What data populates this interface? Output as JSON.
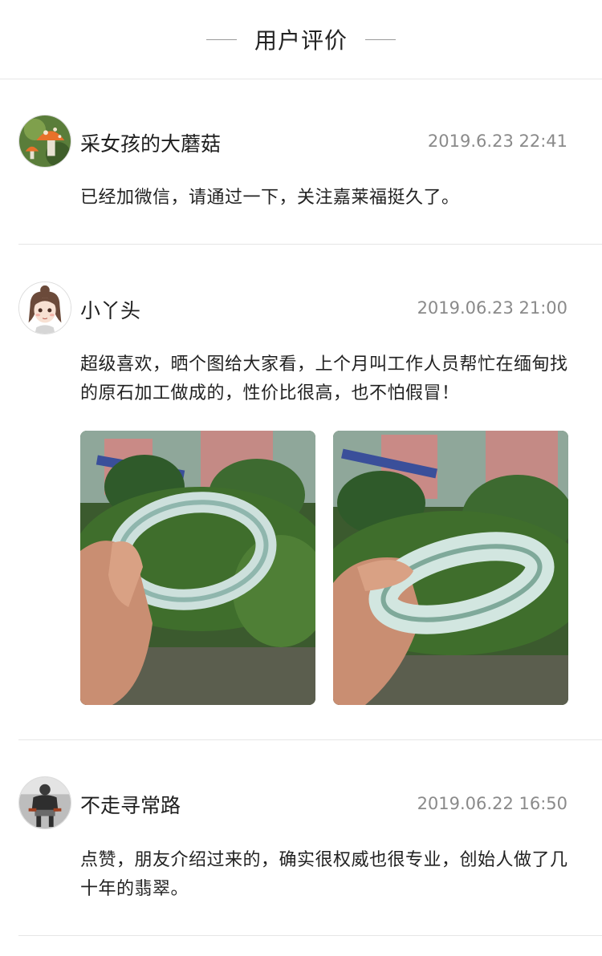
{
  "header": {
    "title": "用户评价"
  },
  "reviews": [
    {
      "username": "采女孩的大蘑菇",
      "time": "2019.6.23 22:41",
      "content": "已经加微信，请通过一下，关注嘉莱福挺久了。",
      "avatar_icon": "mushroom-avatar"
    },
    {
      "username": "小丫头",
      "time": "2019.06.23 21:00",
      "content": "超级喜欢，晒个图给大家看，上个月叫工作人员帮忙在缅甸找的原石加工做成的，性价比很高，也不怕假冒！",
      "avatar_icon": "girl-avatar",
      "photos": [
        "jade-bangle-photo",
        "jade-bangle-photo"
      ]
    },
    {
      "username": "不走寻常路",
      "time": "2019.06.22 16:50",
      "content": "点赞，朋友介绍过来的，确实很权威也很专业，创始人做了几十年的翡翠。",
      "avatar_icon": "person-avatar"
    }
  ]
}
